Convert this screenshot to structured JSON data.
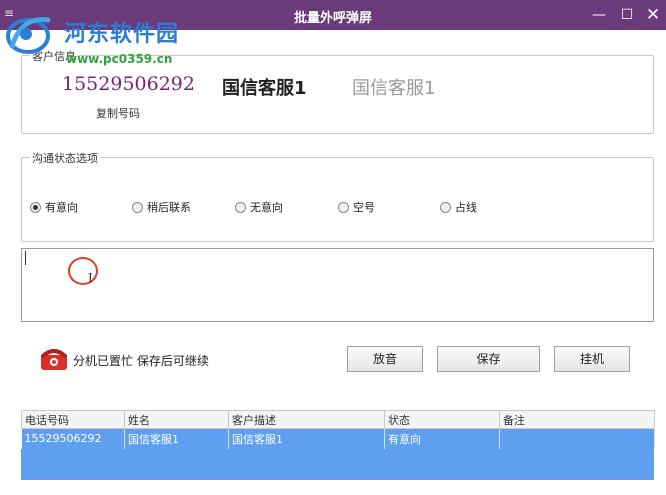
{
  "window": {
    "menu_glyph": "≡",
    "title": "批量外呼弹屏",
    "min_glyph": "—",
    "max_glyph": "☐",
    "close_glyph": "✕"
  },
  "watermark": {
    "name": "河东软件园",
    "url": "www.pc0359.cn"
  },
  "customer": {
    "group_title": "客户信息",
    "phone": "15529506292",
    "copy_label": "复制号码",
    "name_primary": "国信客服1",
    "name_secondary": "国信客服1"
  },
  "status": {
    "group_title": "沟通状态选项",
    "options": [
      {
        "label": "有意向",
        "checked": true
      },
      {
        "label": "稍后联系",
        "checked": false
      },
      {
        "label": "无意向",
        "checked": false
      },
      {
        "label": "空号",
        "checked": false
      },
      {
        "label": "占线",
        "checked": false
      }
    ]
  },
  "notes": {
    "ibeam_glyph": "I"
  },
  "actions": {
    "busy_text": "分机已置忙  保存后可继续",
    "play_label": "放音",
    "save_label": "保存",
    "hangup_label": "挂机"
  },
  "table": {
    "columns": [
      "电话号码",
      "姓名",
      "客户描述",
      "状态",
      "备注"
    ],
    "rows": [
      [
        "15529506292",
        "国信客服1",
        "国信客服1",
        "有意向",
        ""
      ]
    ]
  },
  "colors": {
    "titlebar": "#6a3a7a",
    "phone_text": "#7a1e7a",
    "selected_row": "#5e9ff0",
    "watermark_blue": "#2a7fd4",
    "watermark_green": "#2fa23c"
  }
}
